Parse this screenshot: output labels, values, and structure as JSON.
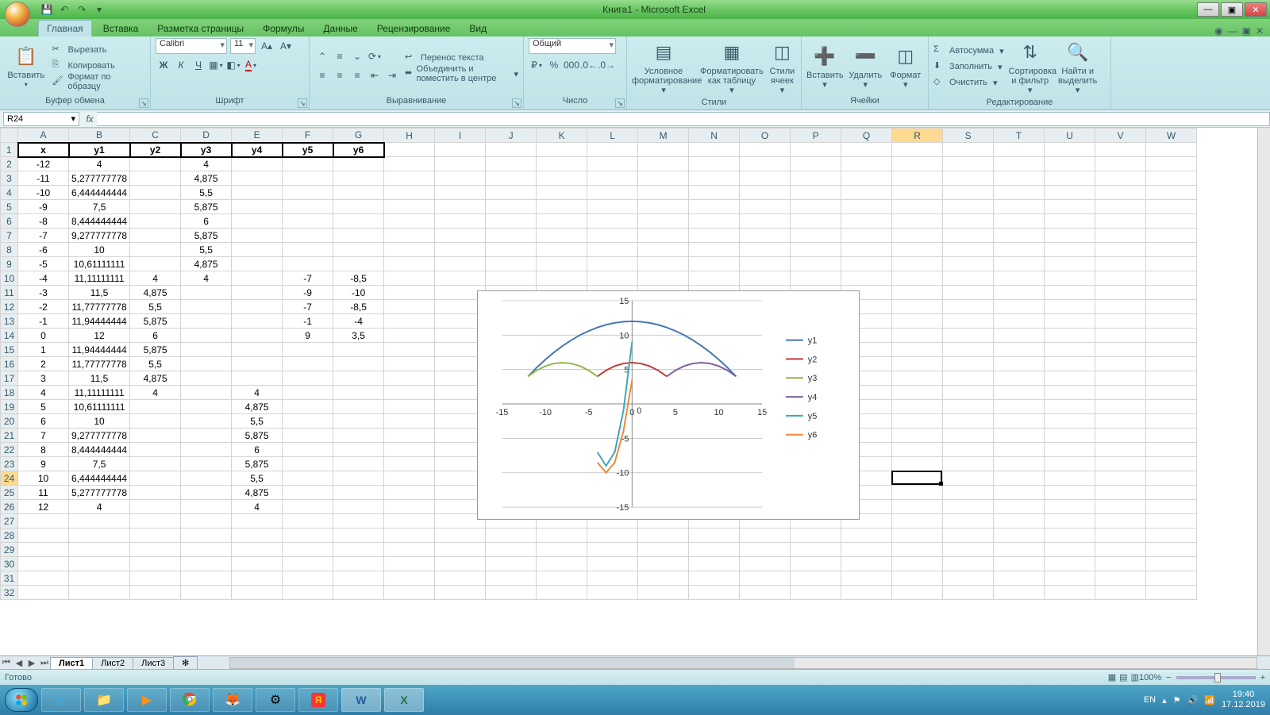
{
  "title": "Книга1 - Microsoft Excel",
  "qat": {
    "save": "💾",
    "undo": "↶",
    "redo": "↷"
  },
  "win": {
    "min": "—",
    "max": "▣",
    "close": "✕"
  },
  "tabs": [
    "Главная",
    "Вставка",
    "Разметка страницы",
    "Формулы",
    "Данные",
    "Рецензирование",
    "Вид"
  ],
  "activeTab": 0,
  "ribbon": {
    "clipboard": {
      "title": "Буфер обмена",
      "paste": "Вставить",
      "cut": "Вырезать",
      "copy": "Копировать",
      "fmtpaint": "Формат по образцу"
    },
    "font": {
      "title": "Шрифт",
      "family": "Calibri",
      "size": "11",
      "b": "Ж",
      "i": "К",
      "u": "Ч"
    },
    "align": {
      "title": "Выравнивание",
      "wrap": "Перенос текста",
      "merge": "Объединить и поместить в центре"
    },
    "number": {
      "title": "Число",
      "format": "Общий"
    },
    "styles": {
      "title": "Стили",
      "cond": "Условное форматирование",
      "fmtTable": "Форматировать как таблицу",
      "cellStyles": "Стили ячеек"
    },
    "cells": {
      "title": "Ячейки",
      "insert": "Вставить",
      "delete": "Удалить",
      "format": "Формат"
    },
    "editing": {
      "title": "Редактирование",
      "sum": "Автосумма",
      "fill": "Заполнить",
      "clear": "Очистить",
      "sort": "Сортировка и фильтр",
      "find": "Найти и выделить"
    }
  },
  "namebox": "R24",
  "columns": [
    "A",
    "B",
    "C",
    "D",
    "E",
    "F",
    "G",
    "H",
    "I",
    "J",
    "K",
    "L",
    "M",
    "N",
    "O",
    "P",
    "Q",
    "R",
    "S",
    "T",
    "U",
    "V",
    "W"
  ],
  "selectedCol": "R",
  "selectedRow": 24,
  "rows": 32,
  "data": {
    "headers": {
      "A": "x",
      "B": "y1",
      "C": "y2",
      "D": "y3",
      "E": "y4",
      "F": "y5",
      "G": "y6"
    },
    "cells": {
      "A2": "-12",
      "B2": "4",
      "D2": "4",
      "A3": "-11",
      "B3": "5,277777778",
      "D3": "4,875",
      "A4": "-10",
      "B4": "6,444444444",
      "D4": "5,5",
      "A5": "-9",
      "B5": "7,5",
      "D5": "5,875",
      "A6": "-8",
      "B6": "8,444444444",
      "D6": "6",
      "A7": "-7",
      "B7": "9,277777778",
      "D7": "5,875",
      "A8": "-6",
      "B8": "10",
      "D8": "5,5",
      "A9": "-5",
      "B9": "10,61111111",
      "D9": "4,875",
      "A10": "-4",
      "B10": "11,11111111",
      "C10": "4",
      "D10": "4",
      "F10": "-7",
      "G10": "-8,5",
      "A11": "-3",
      "B11": "11,5",
      "C11": "4,875",
      "F11": "-9",
      "G11": "-10",
      "A12": "-2",
      "B12": "11,77777778",
      "C12": "5,5",
      "F12": "-7",
      "G12": "-8,5",
      "A13": "-1",
      "B13": "11,94444444",
      "C13": "5,875",
      "F13": "-1",
      "G13": "-4",
      "A14": "0",
      "B14": "12",
      "C14": "6",
      "F14": "9",
      "G14": "3,5",
      "A15": "1",
      "B15": "11,94444444",
      "C15": "5,875",
      "A16": "2",
      "B16": "11,77777778",
      "C16": "5,5",
      "A17": "3",
      "B17": "11,5",
      "C17": "4,875",
      "A18": "4",
      "B18": "11,11111111",
      "C18": "4",
      "E18": "4",
      "A19": "5",
      "B19": "10,61111111",
      "E19": "4,875",
      "A20": "6",
      "B20": "10",
      "E20": "5,5",
      "A21": "7",
      "B21": "9,277777778",
      "E21": "5,875",
      "A22": "8",
      "B22": "8,444444444",
      "E22": "6",
      "A23": "9",
      "B23": "7,5",
      "E23": "5,875",
      "A24": "10",
      "B24": "6,444444444",
      "E24": "5,5",
      "A25": "11",
      "B25": "5,277777778",
      "E25": "4,875",
      "A26": "12",
      "B26": "4",
      "E26": "4"
    }
  },
  "sheets": [
    "Лист1",
    "Лист2",
    "Лист3"
  ],
  "activeSheet": 0,
  "status": "Готово",
  "zoom": "100%",
  "lang": "EN",
  "time": "19:40",
  "date": "17.12.2019",
  "chart_data": {
    "type": "line",
    "xlabel": "",
    "ylabel": "",
    "xlim": [
      -15,
      15
    ],
    "ylim": [
      -15,
      15
    ],
    "xticks": [
      -15,
      -10,
      -5,
      0,
      5,
      10,
      15
    ],
    "yticks": [
      -15,
      -10,
      -5,
      0,
      5,
      10,
      15
    ],
    "legend": [
      "y1",
      "y2",
      "y3",
      "y4",
      "y5",
      "y6"
    ],
    "colors": {
      "y1": "#4577b5",
      "y2": "#bd3d3a",
      "y3": "#93b54a",
      "y4": "#7d60a0",
      "y5": "#3ea6b8",
      "y6": "#ec8a3b"
    },
    "series": [
      {
        "name": "y1",
        "x": [
          -12,
          -11,
          -10,
          -9,
          -8,
          -7,
          -6,
          -5,
          -4,
          -3,
          -2,
          -1,
          0,
          1,
          2,
          3,
          4,
          5,
          6,
          7,
          8,
          9,
          10,
          11,
          12
        ],
        "y": [
          4,
          5.278,
          6.444,
          7.5,
          8.444,
          9.278,
          10,
          10.611,
          11.111,
          11.5,
          11.778,
          11.944,
          12,
          11.944,
          11.778,
          11.5,
          11.111,
          10.611,
          10,
          9.278,
          8.444,
          7.5,
          6.444,
          5.278,
          4
        ]
      },
      {
        "name": "y2",
        "x": [
          -4,
          -3,
          -2,
          -1,
          0,
          1,
          2,
          3,
          4
        ],
        "y": [
          4,
          4.875,
          5.5,
          5.875,
          6,
          5.875,
          5.5,
          4.875,
          4
        ]
      },
      {
        "name": "y3",
        "x": [
          -12,
          -11,
          -10,
          -9,
          -8,
          -7,
          -6,
          -5,
          -4
        ],
        "y": [
          4,
          4.875,
          5.5,
          5.875,
          6,
          5.875,
          5.5,
          4.875,
          4
        ]
      },
      {
        "name": "y4",
        "x": [
          4,
          5,
          6,
          7,
          8,
          9,
          10,
          11,
          12
        ],
        "y": [
          4,
          4.875,
          5.5,
          5.875,
          6,
          5.875,
          5.5,
          4.875,
          4
        ]
      },
      {
        "name": "y5",
        "x": [
          -4,
          -3,
          -2,
          -1,
          0
        ],
        "y": [
          -7,
          -9,
          -7,
          -1,
          9
        ]
      },
      {
        "name": "y6",
        "x": [
          -4,
          -3,
          -2,
          -1,
          0
        ],
        "y": [
          -8.5,
          -10,
          -8.5,
          -4,
          3.5
        ]
      }
    ]
  }
}
